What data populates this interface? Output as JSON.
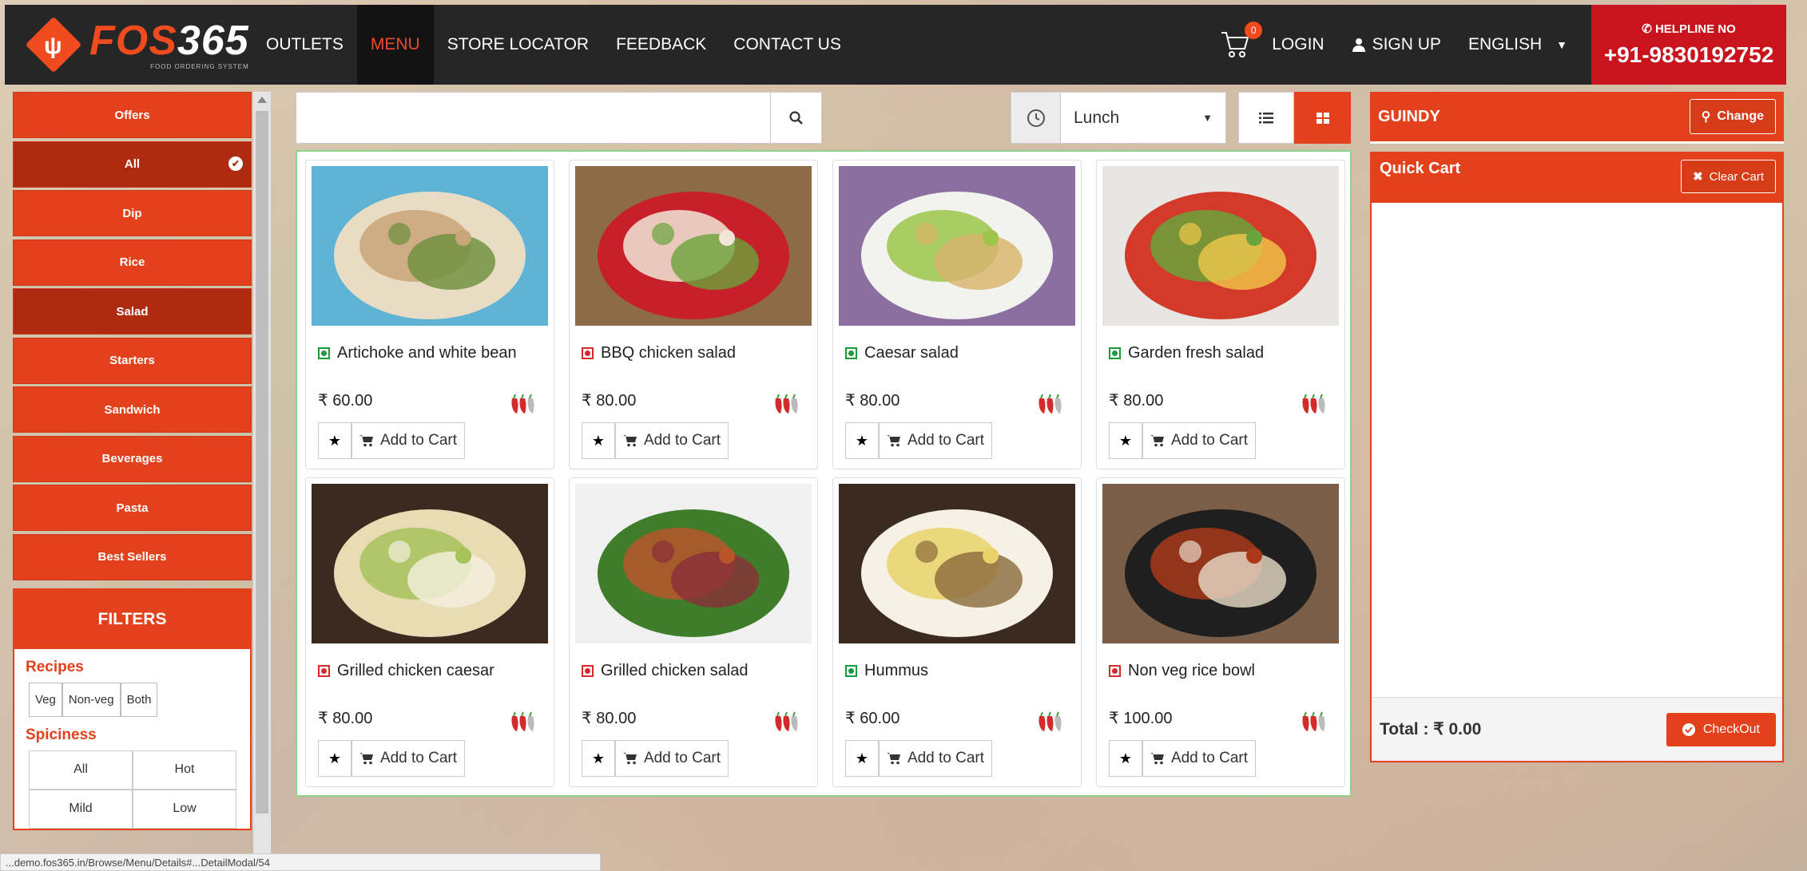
{
  "brand": {
    "name_part1": "FOS",
    "name_part2": "365",
    "tagline": "FOOD ORDERING SYSTEM"
  },
  "nav": {
    "items": [
      {
        "label": "OUTLETS"
      },
      {
        "label": "MENU"
      },
      {
        "label": "STORE LOCATOR"
      },
      {
        "label": "FEEDBACK"
      },
      {
        "label": "CONTACT US"
      }
    ],
    "active": "MENU"
  },
  "header": {
    "cart_count": "0",
    "login": "LOGIN",
    "signup": "SIGN UP",
    "language": "ENGLISH",
    "helpline_label": "HELPLINE NO",
    "helpline_number": "+91-9830192752"
  },
  "categories": [
    {
      "label": "Offers"
    },
    {
      "label": "All"
    },
    {
      "label": "Dip"
    },
    {
      "label": "Rice"
    },
    {
      "label": "Salad"
    },
    {
      "label": "Starters"
    },
    {
      "label": "Sandwich"
    },
    {
      "label": "Beverages"
    },
    {
      "label": "Pasta"
    },
    {
      "label": "Best Sellers"
    }
  ],
  "filters": {
    "title": "FILTERS",
    "recipes_label": "Recipes",
    "recipes": [
      "Veg",
      "Non-veg",
      "Both"
    ],
    "spiciness_label": "Spiciness",
    "spiciness": [
      "All",
      "Hot",
      "Mild",
      "Low"
    ]
  },
  "search": {
    "value": "",
    "placeholder": ""
  },
  "meal": {
    "selected": "Lunch"
  },
  "location": {
    "name": "GUINDY",
    "change_label": "Change"
  },
  "quick_cart": {
    "title": "Quick Cart",
    "clear_label": "Clear Cart",
    "total_label": "Total : ₹ 0.00",
    "checkout_label": "CheckOut"
  },
  "products": [
    {
      "name": "Artichoke and white bean",
      "price": "₹ 60.00",
      "diet": "veg",
      "add_label": "Add to Cart"
    },
    {
      "name": "BBQ chicken salad",
      "price": "₹ 80.00",
      "diet": "nonveg",
      "add_label": "Add to Cart"
    },
    {
      "name": "Caesar salad",
      "price": "₹ 80.00",
      "diet": "veg",
      "add_label": "Add to Cart"
    },
    {
      "name": "Garden fresh salad",
      "price": "₹ 80.00",
      "diet": "veg",
      "add_label": "Add to Cart"
    },
    {
      "name": "Grilled chicken caesar",
      "price": "₹ 80.00",
      "diet": "nonveg",
      "add_label": "Add to Cart"
    },
    {
      "name": "Grilled chicken salad",
      "price": "₹ 80.00",
      "diet": "nonveg",
      "add_label": "Add to Cart"
    },
    {
      "name": "Hummus",
      "price": "₹ 60.00",
      "diet": "veg",
      "add_label": "Add to Cart"
    },
    {
      "name": "Non veg rice bowl",
      "price": "₹ 100.00",
      "diet": "nonveg",
      "add_label": "Add to Cart"
    }
  ],
  "status_bar": {
    "url": "...demo.fos365.in/Browse/Menu/Details#...DetailModal/54"
  },
  "colors": {
    "accent": "#e2411b",
    "topbar": "#262626",
    "helpline": "#c9141d",
    "veg": "#1a9a3a",
    "nonveg": "#d42a2a"
  }
}
